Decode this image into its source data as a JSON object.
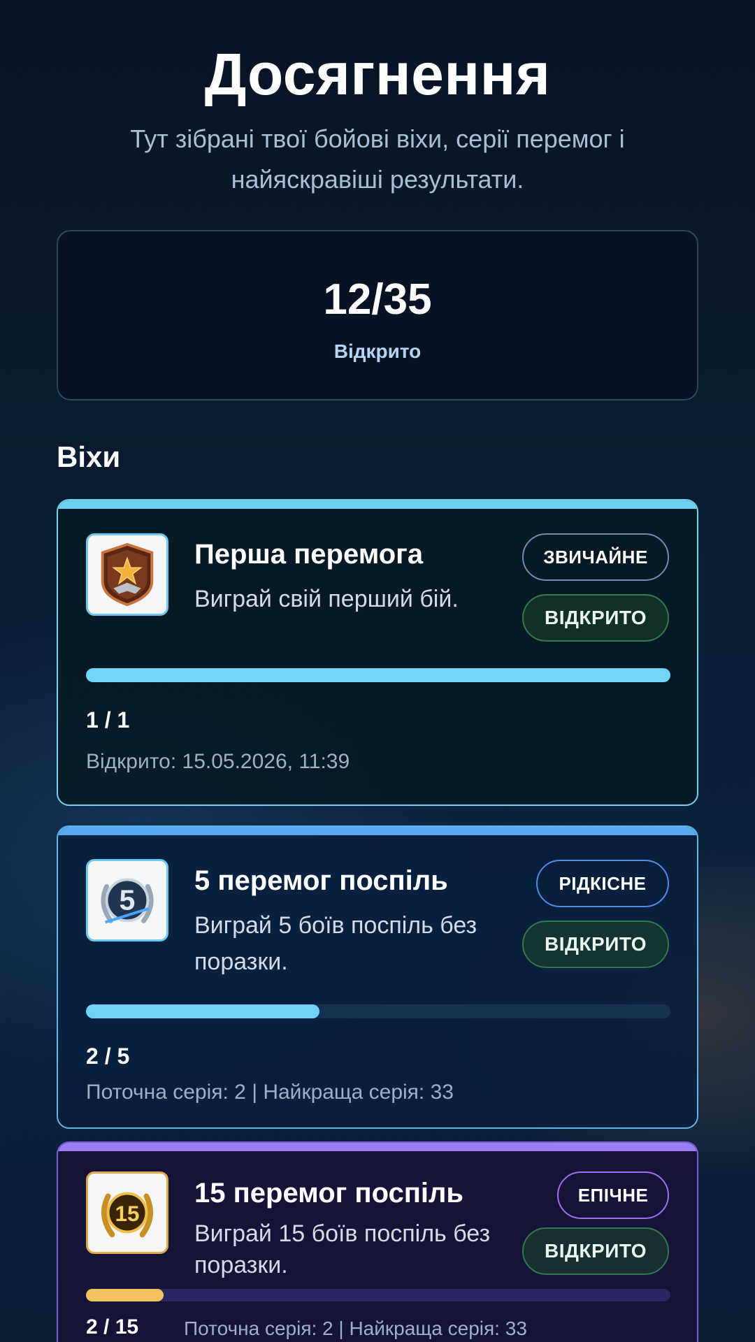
{
  "header": {
    "title": "Досягнення",
    "subtitle": "Тут зібрані твої бойові віхи, серії перемог і найяскравіші результати."
  },
  "summary": {
    "count": "12/35",
    "label": "Відкрито"
  },
  "section": {
    "title": "Віхи"
  },
  "achievements": [
    {
      "title": "Перша перемога",
      "description": "Виграй свій перший бій.",
      "rarity": "ЗВИЧАЙНЕ",
      "status": "ВІДКРИТО",
      "progress_text": "1 / 1",
      "progress_fraction": 1.0,
      "meta": "Відкрито: 15.05.2026, 11:39",
      "icon": "bronze-star-medal-icon",
      "accent_color": "#6fd2f5"
    },
    {
      "title": "5 перемог поспіль",
      "description": "Виграй 5 боїв поспіль без поразки.",
      "rarity": "РІДКІСНЕ",
      "status": "ВІДКРИТО",
      "progress_text": "2 / 5",
      "progress_fraction": 0.4,
      "meta": "Поточна серія: 2 | Найкраща серія: 33",
      "icon": "silver-5-wreath-icon",
      "accent_color": "#58a8f0"
    },
    {
      "title": "15 перемог поспіль",
      "description": "Виграй 15 боїв поспіль без поразки.",
      "rarity": "ЕПІЧНЕ",
      "status": "ВІДКРИТО",
      "progress_text": "2 / 15",
      "progress_fraction": 0.1333,
      "meta": "Поточна серія: 2 | Найкраща серія: 33",
      "icon": "gold-15-wreath-icon",
      "accent_color": "#9a7ef4"
    }
  ]
}
